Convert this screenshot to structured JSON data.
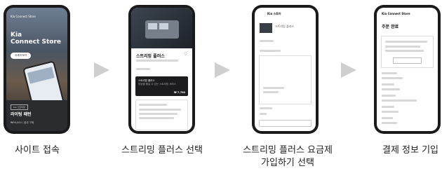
{
  "steps": [
    {
      "caption": "사이트 접속",
      "screen": {
        "logo": "Kia Connect Store",
        "title_line1": "Kia",
        "title_line2": "Connect Store",
        "button": "자세히 보기",
        "tag": "Kia 스트리밍",
        "panel_title": "라이팅 패턴",
        "panel_sub": "₩99,000 / 옵션 구매"
      }
    },
    {
      "caption": "스트리밍 플러스 선택",
      "screen": {
        "heading": "스트리밍 플러스",
        "card_line1": "스트리밍 플러스",
        "card_line2": "영상을 즐길 수 있는 스트리밍 서비스",
        "price": "₩ 7,700"
      }
    },
    {
      "caption_line1": "스트리밍 플러스 요금제",
      "caption_line2": "가입하기 선택",
      "screen": {
        "header": "Kia 스토어",
        "product": "스트리밍 플러스"
      }
    },
    {
      "caption": "결제 정보 기입",
      "screen": {
        "logo": "Kia Connect Store",
        "heading": "주문 완료"
      }
    }
  ],
  "icons": {
    "arrow": "chevron-right-arrow",
    "heart": "heart-icon"
  }
}
